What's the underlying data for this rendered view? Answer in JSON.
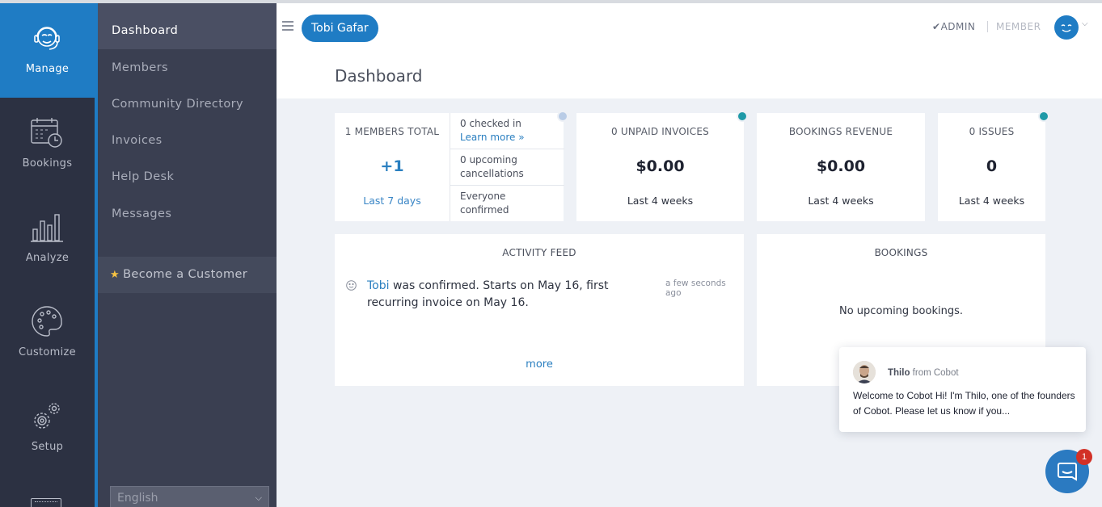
{
  "rail": {
    "items": [
      {
        "label": "Manage",
        "icon": "headset-agent-icon",
        "active": true
      },
      {
        "label": "Bookings",
        "icon": "calendar-clock-icon"
      },
      {
        "label": "Analyze",
        "icon": "bar-chart-icon"
      },
      {
        "label": "Customize",
        "icon": "palette-icon"
      },
      {
        "label": "Setup",
        "icon": "gears-icon"
      }
    ]
  },
  "subnav": {
    "items": [
      {
        "label": "Dashboard",
        "active": true
      },
      {
        "label": "Members"
      },
      {
        "label": "Community Directory"
      },
      {
        "label": "Invoices"
      },
      {
        "label": "Help Desk"
      },
      {
        "label": "Messages"
      }
    ],
    "become_customer": "Become a Customer",
    "language": "English"
  },
  "header": {
    "user_name": "Tobi Gafar",
    "role_admin": "ADMIN",
    "role_member": "MEMBER",
    "page_title": "Dashboard"
  },
  "stats": {
    "members": {
      "title": "1 MEMBERS TOTAL",
      "value": "+1",
      "footer": "Last 7 days"
    },
    "checkins": [
      {
        "text": "0 checked in",
        "link": "Learn more »"
      },
      {
        "text": "0 upcoming cancellations"
      },
      {
        "text": "Everyone confirmed"
      }
    ],
    "unpaid": {
      "title": "0 UNPAID INVOICES",
      "value": "$0.00",
      "footer": "Last 4 weeks"
    },
    "revenue": {
      "title": "BOOKINGS REVENUE",
      "value": "$0.00",
      "footer": "Last 4 weeks"
    },
    "issues": {
      "title": "0 ISSUES",
      "value": "0",
      "footer": "Last 4 weeks"
    }
  },
  "activity": {
    "title": "ACTIVITY FEED",
    "entry_name": "Tobi",
    "entry_text": " was confirmed. Starts on May 16, first recurring invoice on May 16.",
    "entry_time": "a few seconds ago",
    "more": "more"
  },
  "bookings": {
    "title": "BOOKINGS",
    "empty": "No upcoming bookings."
  },
  "chat": {
    "sender": "Thilo",
    "from": " from Cobot",
    "message": "Welcome to Cobot Hi! I'm Thilo, one of the founders of Cobot. Please let us know if you...",
    "badge": "1"
  },
  "colors": {
    "accent": "#1f7cc4",
    "rail_bg": "#2c3142",
    "subnav_bg": "#3a3f51",
    "dot_teal": "#1f9aa8",
    "dot_light": "#b9cce6"
  }
}
